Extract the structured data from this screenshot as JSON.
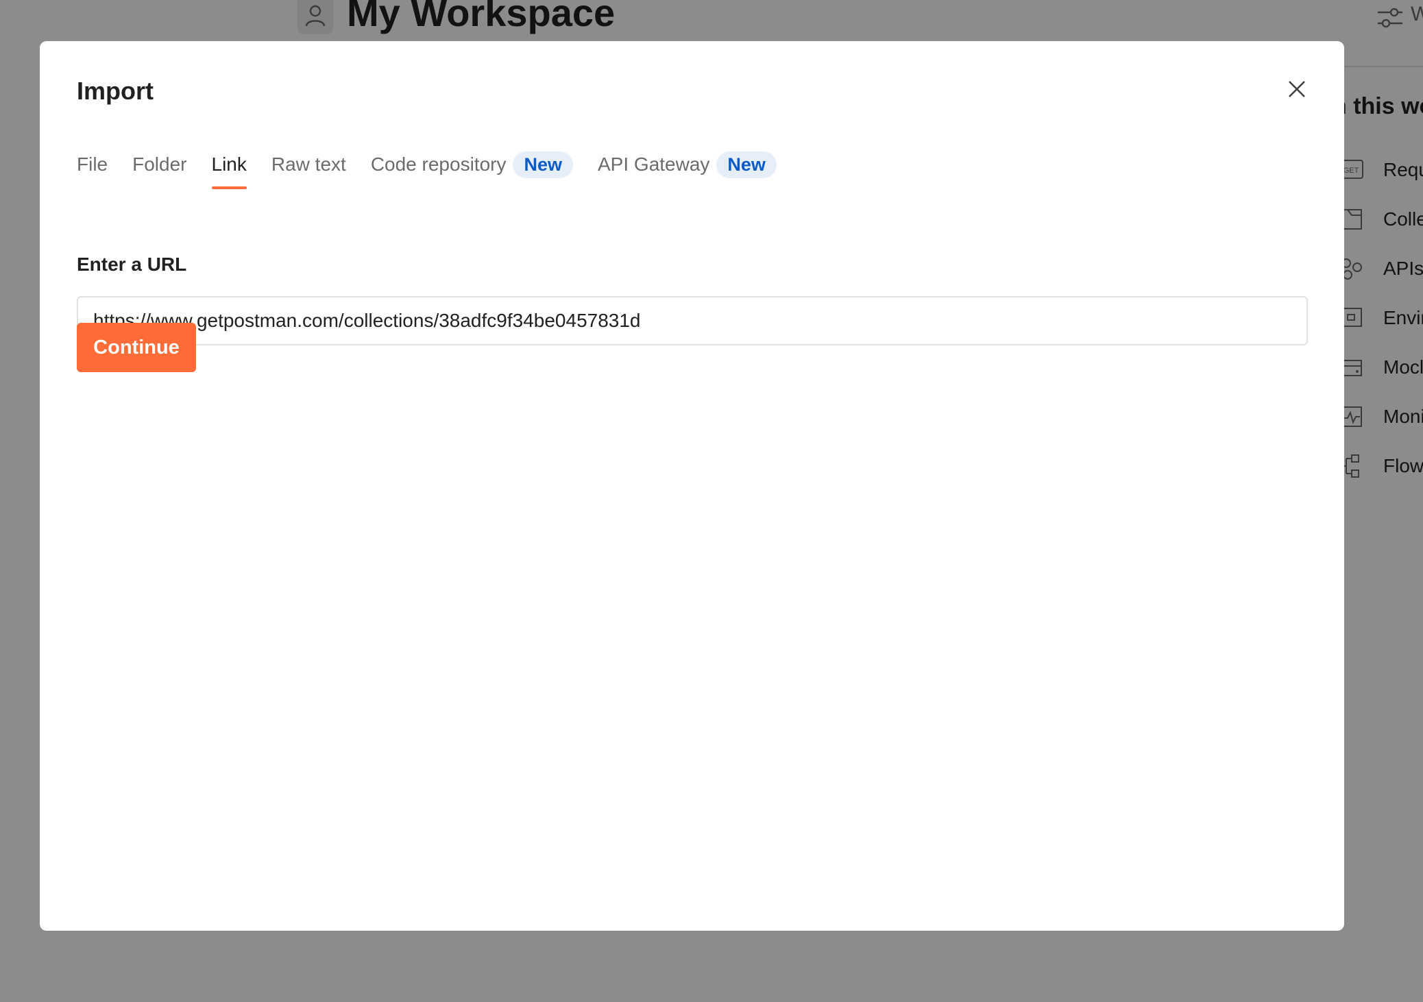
{
  "workspace": {
    "title": "My Workspace",
    "settings_label": "W",
    "right_panel_heading": "n this wo",
    "items": [
      {
        "label": "Requ",
        "icon": "get-request-icon"
      },
      {
        "label": "Colle",
        "icon": "collection-icon"
      },
      {
        "label": "APIs",
        "icon": "apis-icon"
      },
      {
        "label": "Envir",
        "icon": "environment-icon"
      },
      {
        "label": "Mocl",
        "icon": "mock-server-icon"
      },
      {
        "label": "Moni",
        "icon": "monitor-icon"
      },
      {
        "label": "Flow",
        "icon": "flows-icon"
      }
    ],
    "get_icon_text": "GET"
  },
  "dialog": {
    "title": "Import",
    "tabs": [
      {
        "label": "File",
        "active": false
      },
      {
        "label": "Folder",
        "active": false
      },
      {
        "label": "Link",
        "active": true
      },
      {
        "label": "Raw text",
        "active": false
      },
      {
        "label": "Code repository",
        "badge": "New",
        "active": false
      },
      {
        "label": "API Gateway",
        "badge": "New",
        "active": false
      }
    ],
    "url_label": "Enter a URL",
    "url_value": "https://www.getpostman.com/collections/38adfc9f34be0457831d",
    "continue_label": "Continue"
  },
  "colors": {
    "accent": "#ff6c37",
    "badge_bg": "#e6eefa",
    "badge_text": "#0b5cc8",
    "overlay": "rgba(0,0,0,0.45)"
  }
}
